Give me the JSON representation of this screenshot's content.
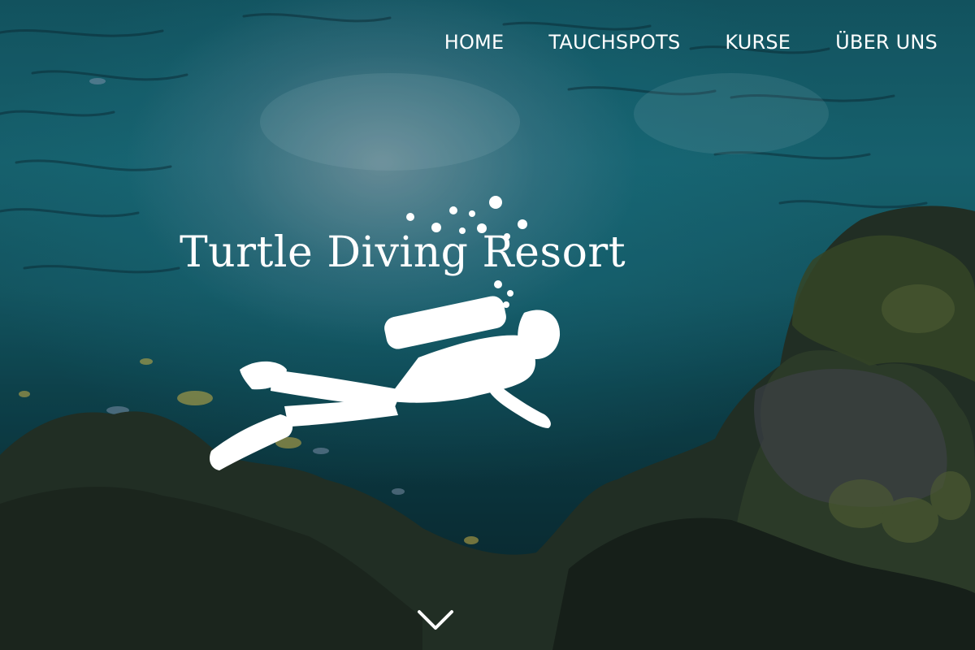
{
  "nav": {
    "items": [
      {
        "label": "HOME"
      },
      {
        "label": "TAUCHSPOTS"
      },
      {
        "label": "KURSE"
      },
      {
        "label": "ÜBER UNS"
      }
    ]
  },
  "hero": {
    "brand_name": "Turtle Diving Resort",
    "logo_icon": "scuba-diver-icon",
    "scroll_icon": "chevron-down-icon"
  },
  "colors": {
    "text": "#ffffff",
    "water_light": "#1a6e7c",
    "water_dark": "#0a2a30",
    "reef": "#2a3a2e"
  }
}
